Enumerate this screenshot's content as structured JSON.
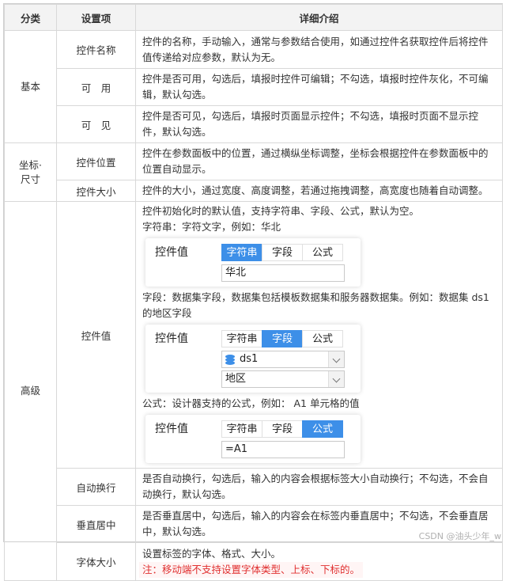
{
  "headers": {
    "category": "分类",
    "item": "设置项",
    "detail": "详细介绍"
  },
  "groups": {
    "basic": "基本",
    "coord": "坐标·尺寸",
    "advanced": "高级"
  },
  "rows": {
    "name": {
      "item": "控件名称",
      "desc": "控件的名称，手动输入，通常与参数结合使用，如通过控件名获取控件后将控件值传递给对应参数，默认为无。"
    },
    "usable": {
      "item": "可　用",
      "desc": "控件是否可用，勾选后，填报时控件可编辑；不勾选，填报时控件灰化，不可编辑，默认勾选。"
    },
    "visible": {
      "item": "可　见",
      "desc": "控件是否可见，勾选后，填报时页面显示控件；不勾选，填报时页面不显示控件，默认勾选。"
    },
    "position": {
      "item": "控件位置",
      "desc": "控件在参数面板中的位置，通过横纵坐标调整，坐标会根据控件在参数面板中的位置自动显示。"
    },
    "size": {
      "item": "控件大小",
      "desc": "控件的大小，通过宽度、高度调整，若通过拖拽调整，高宽度也随着自动调整。"
    },
    "value": {
      "item": "控件值",
      "intro": "控件初始化时的默认值，支持字符串、字段、公式，默认为空。",
      "string_desc": "字符串：字符文字，例如：华北",
      "field_desc": "字段：数据集字段，数据集包括模板数据集和服务器数据集。例如：数据集 ds1 的地区字段",
      "formula_desc": "公式：设计器支持的公式，例如： A1 单元格的值",
      "panel_label": "控件值",
      "tabs": [
        "字符串",
        "字段",
        "公式"
      ],
      "string_value": "华北",
      "dataset_value": "ds1",
      "field_value": "地区",
      "formula_value": "=A1"
    },
    "autowrap": {
      "item": "自动换行",
      "desc": "是否自动换行，勾选后，输入的内容会根据标签大小自动换行；不勾选，不会自动换行，默认勾选。"
    },
    "vcenter": {
      "item": "垂直居中",
      "desc": "是否垂直居中，勾选后，输入的内容会在标签内垂直居中；不勾选，不会垂直居中，默认勾选。"
    },
    "font": {
      "item": "字体大小",
      "desc": "设置标签的字体、格式、大小。",
      "note": "注：移动端不支持设置字体类型、上标、下标的。"
    }
  },
  "watermark": "CSDN @油头少年_w",
  "colors": {
    "accent": "#3d8fe8",
    "note": "#e03030",
    "header_bg": "#f3f3f3"
  }
}
